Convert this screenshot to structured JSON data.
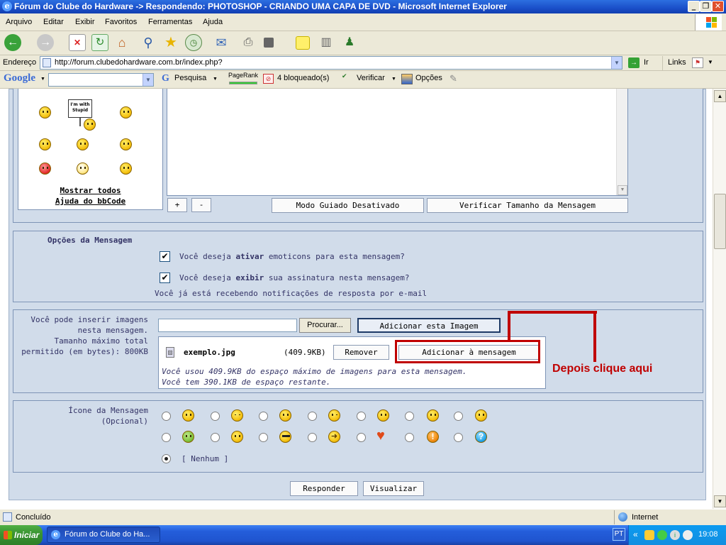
{
  "window": {
    "title": "Fórum do Clube do Hardware -> Respondendo: PHOTOSHOP - CRIANDO UMA CAPA DE DVD - Microsoft Internet Explorer",
    "minimize": "_",
    "maximize": "❐",
    "close": "✕"
  },
  "menu": [
    "Arquivo",
    "Editar",
    "Exibir",
    "Favoritos",
    "Ferramentas",
    "Ajuda"
  ],
  "address": {
    "label": "Endereço",
    "url": "http://forum.clubedohardware.com.br/index.php?",
    "go_label": "Ir",
    "links_label": "Links"
  },
  "google": {
    "logo": "Google",
    "search_label": "Pesquisa",
    "pagerank_label": "PageRank",
    "blocked_label": "4 bloqueado(s)",
    "check_label": "Verificar",
    "options_label": "Opções"
  },
  "editor": {
    "sign_text": "I'm with Stupid",
    "show_all": "Mostrar todos",
    "bbcode_help": "Ajuda do bbCode",
    "plus": "+",
    "minus": "-",
    "guided_mode": "Modo Guiado Desativado",
    "check_size": "Verificar Tamanho da Mensagem"
  },
  "options": {
    "title": "Opções da Mensagem",
    "smilies_pre": "Você deseja",
    "smilies_bold": "ativar",
    "smilies_post": "emoticons para esta mensagem?",
    "signature_pre": "Você deseja",
    "signature_bold": "exibir",
    "signature_post": "sua assinatura nesta mensagem?",
    "notify": "Você já está recebendo notificações de resposta por e-mail",
    "smilies_checked": true,
    "signature_checked": true
  },
  "attach": {
    "info_1": "Você pode inserir imagens",
    "info_2": "nesta mensagem.",
    "info_3": "Tamanho máximo total",
    "info_4": "permitido (em bytes): 800KB",
    "browse": "Procurar...",
    "add_image": "Adicionar esta Imagem",
    "filename": "exemplo.jpg",
    "filesize": "(409.9KB)",
    "remove": "Remover",
    "add_to_message": "Adicionar à mensagem",
    "used": "Você usou 409.9KB do espaço máximo de imagens para esta mensagem.",
    "remaining": "Você tem 390.1KB de espaço restante.",
    "annotation": "Depois clique aqui",
    "annotation_color": "#c00000"
  },
  "icon_section": {
    "title": "Ícone da Mensagem",
    "subtitle": "(Opcional)",
    "none": "[ Nenhum ]",
    "row1_icons": [
      "smile-icon",
      "sleepy-icon",
      "sad-icon",
      "wink-icon",
      "shocked-icon",
      "grin-icon",
      "angry-icon"
    ],
    "row2_icons": [
      "sick-icon",
      "tongue-icon",
      "cool-icon",
      "arrow-icon",
      "heart-icon",
      "exclamation-icon",
      "question-icon"
    ],
    "selected": "none"
  },
  "actions": {
    "reply": "Responder",
    "preview": "Visualizar"
  },
  "status": {
    "text": "Concluído",
    "zone": "Internet"
  },
  "taskbar": {
    "start": "Iniciar",
    "task": "Fórum do Clube do Ha...",
    "lang": "PT",
    "clock": "19:08"
  },
  "colors": {
    "panel": "#d1dcea",
    "border": "#7e94b6",
    "label": "#333366"
  }
}
